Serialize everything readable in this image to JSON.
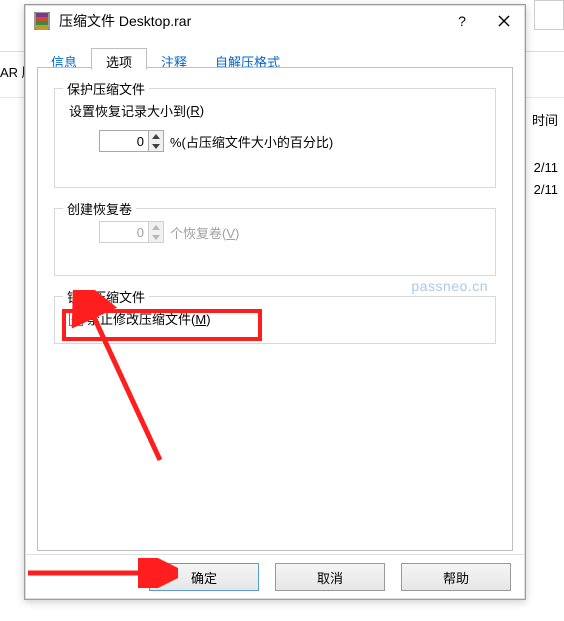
{
  "background": {
    "left_col_truncated": "AR 压",
    "right_col_truncated": "时间",
    "date_line_1": "2/11",
    "date_line_2": "2/11"
  },
  "dialog": {
    "title": "压缩文件 Desktop.rar",
    "help_symbol": "?",
    "tabs": {
      "info": "信息",
      "options": "选项",
      "comments": "注释",
      "sfx": "自解压格式"
    },
    "group_protect": {
      "legend": "保护压缩文件",
      "desc_prefix": "设置恢复记录大小到(",
      "desc_ul": "R",
      "desc_suffix": ")",
      "value": "0",
      "unit_text": "%(占压缩文件大小的百分比)"
    },
    "group_volumes": {
      "legend": "创建恢复卷",
      "value": "0",
      "unit_prefix": "个恢复卷(",
      "unit_ul": "V",
      "unit_suffix": ")"
    },
    "group_lock": {
      "legend": "锁定压缩文件",
      "checkbox_prefix": "禁止修改压缩文件(",
      "checkbox_ul": "M",
      "checkbox_suffix": ")"
    },
    "watermark": "passneo.cn",
    "buttons": {
      "ok": "确定",
      "cancel": "取消",
      "help": "帮助"
    }
  }
}
